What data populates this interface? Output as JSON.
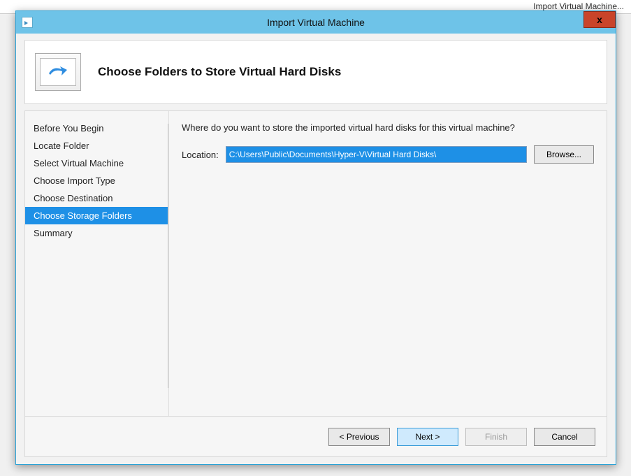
{
  "background": {
    "right_action": "Import Virtual Machine..."
  },
  "window": {
    "title": "Import Virtual Machine",
    "close_glyph": "x"
  },
  "header": {
    "page_title": "Choose Folders to Store Virtual Hard Disks"
  },
  "sidebar": {
    "steps": [
      {
        "label": "Before You Begin",
        "active": false
      },
      {
        "label": "Locate Folder",
        "active": false
      },
      {
        "label": "Select Virtual Machine",
        "active": false
      },
      {
        "label": "Choose Import Type",
        "active": false
      },
      {
        "label": "Choose Destination",
        "active": false
      },
      {
        "label": "Choose Storage Folders",
        "active": true
      },
      {
        "label": "Summary",
        "active": false
      }
    ]
  },
  "content": {
    "prompt": "Where do you want to store the imported virtual hard disks for this virtual machine?",
    "location_label": "Location:",
    "location_value": "C:\\Users\\Public\\Documents\\Hyper-V\\Virtual Hard Disks\\",
    "browse_label": "Browse..."
  },
  "footer": {
    "previous": "< Previous",
    "next": "Next >",
    "finish": "Finish",
    "cancel": "Cancel"
  }
}
